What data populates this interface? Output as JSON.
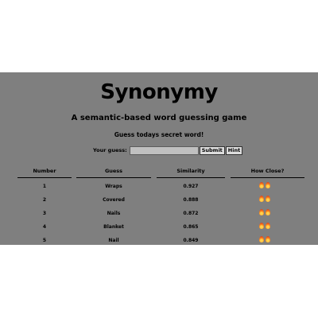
{
  "app": {
    "title": "Synonymy",
    "subtitle": "A semantic-based word guessing game",
    "instruction": "Guess todays secret word!"
  },
  "guess_form": {
    "label": "Your guess:",
    "value": "",
    "placeholder": "",
    "submit_label": "Submit",
    "hint_label": "Hint"
  },
  "table": {
    "headers": {
      "number": "Number",
      "guess": "Guess",
      "similarity": "Similarity",
      "how_close": "How Close?"
    },
    "rows": [
      {
        "number": "1",
        "guess": "Wraps",
        "similarity": "0.927",
        "fires": 2
      },
      {
        "number": "2",
        "guess": "Covered",
        "similarity": "0.888",
        "fires": 2
      },
      {
        "number": "3",
        "guess": "Nails",
        "similarity": "0.872",
        "fires": 2
      },
      {
        "number": "4",
        "guess": "Blanket",
        "similarity": "0.865",
        "fires": 2
      },
      {
        "number": "5",
        "guess": "Nail",
        "similarity": "0.849",
        "fires": 2
      }
    ]
  },
  "colors": {
    "page_background": "#ffffff",
    "app_background": "#7f7f7f",
    "fire_orange": "#ff8a1e"
  },
  "icons": {
    "closeness_icon": "fire-icon"
  }
}
